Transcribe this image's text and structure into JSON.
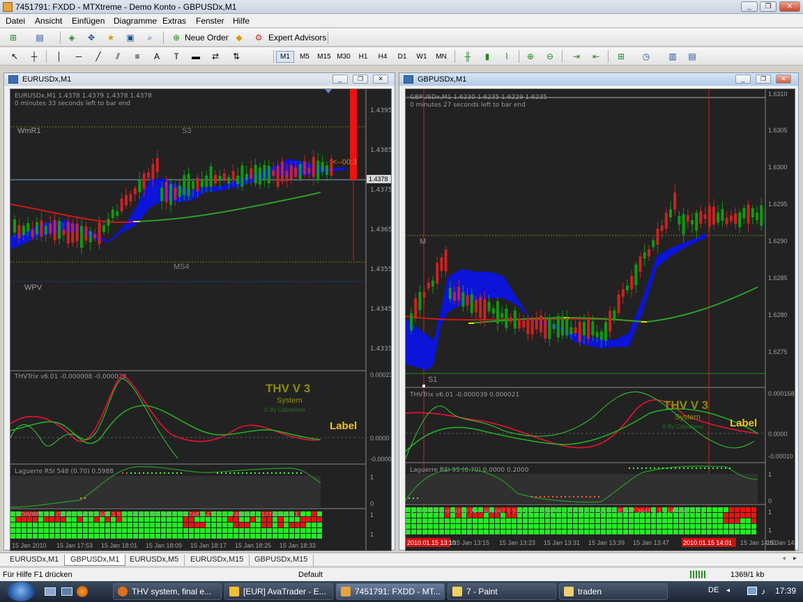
{
  "window": {
    "title": "7451791: FXDD - MTXtreme - Demo Konto - GBPUSDx,M1"
  },
  "menu": [
    "Datei",
    "Ansicht",
    "Einfügen",
    "Diagramme",
    "Extras",
    "Fenster",
    "Hilfe"
  ],
  "toolbar1": {
    "new_order": "Neue Order",
    "expert_advisors": "Expert Advisors"
  },
  "timeframes": [
    "M1",
    "M5",
    "M15",
    "M30",
    "H1",
    "H4",
    "D1",
    "W1",
    "MN"
  ],
  "active_timeframe": "M1",
  "chart_left": {
    "title": "EURUSDx,M1",
    "info": "EURUSDx,M1  1.4378 1.4379 1.4378 1.4378",
    "timer": "0 minutes 33 seconds left to bar end",
    "levels": {
      "wmr1": "WmR1",
      "s3": "S3",
      "ms4": "MS4",
      "wpv": "WPV"
    },
    "countdown": "<--00:3",
    "price_current": "1.4378",
    "prices": [
      "1.4395",
      "1.4385",
      "1.4375",
      "1.4365",
      "1.4355",
      "1.4345",
      "1.4335"
    ],
    "trix_label": "THVTrix v6.01 -0.000008 -0.000026",
    "trix_scale": [
      "0.000231",
      "0.0000",
      "-0.00008"
    ],
    "thv_title": "THV V 3",
    "thv_system": "System",
    "thv_by": "© By Cobraforex",
    "thv_label": "Label",
    "laguerre_label": "Laguerre RSI 548 (0.70) 0.5988",
    "laguerre_scale": [
      "1",
      "0"
    ],
    "mtf_label": "1 THVMFTrend (9263 2147483647 1 5) 2147483647 3647 2147483647 3 2147483647 2147483647 1",
    "mtf_scale": [
      "1",
      "1"
    ],
    "times": [
      "15 Jan 2010",
      "15 Jan 17:53",
      "15 Jan 18:01",
      "15 Jan 18:09",
      "15 Jan 18:17",
      "15 Jan 18:25",
      "15 Jan 18:33"
    ]
  },
  "chart_right": {
    "title": "GBPUSDx,M1",
    "info": "GBPUSDx,M1  1.6230 1.6235 1.6229 1.6235",
    "timer": "0 minutes 27 seconds left to bar end",
    "levels": {
      "s1": "S1",
      "m": "M"
    },
    "prices": [
      "1.6310",
      "1.6305",
      "1.6300",
      "1.6295",
      "1.6290",
      "1.6285",
      "1.6280",
      "1.6275"
    ],
    "trix_label": "THVTrix v6.01 -0.000039 0.000021",
    "trix_scale": [
      "0.000168",
      "0.0000",
      "-0.00010"
    ],
    "thv_title": "THV V 3",
    "thv_system": "System",
    "thv_by": "© By Cobraforex",
    "thv_label": "Label",
    "laguerre_label": "Laguerre RSI 95 (0.70) 0.0000 0.2000",
    "laguerre_scale": [
      "1",
      "0"
    ],
    "mtf_label": "1 THVMFTrend (9263 2147483647 1 5) 3 2147483647 2147483647 2147483647 3647 2 1 2147483647 1",
    "mtf_scale": [
      "1",
      "1"
    ],
    "times": [
      "2010.01.15 13:10",
      "15 Jan 13:15",
      "15 Jan 13:23",
      "15 Jan 13:31",
      "15 Jan 13:39",
      "15 Jan 13:47",
      "2010.01.15 14:01",
      "15 Jan 14:03",
      "15 Jan 14"
    ]
  },
  "tabs": [
    "EURUSDx,M1",
    "GBPUSDx,M1",
    "EURUSDx,M5",
    "EURUSDx,M15",
    "GBPUSDx,M15"
  ],
  "active_tab": "GBPUSDx,M1",
  "status": {
    "help": "Für Hilfe F1 drücken",
    "profile": "Default",
    "traffic": "1369/1 kb"
  },
  "taskbar": {
    "items": [
      "THV system, final e...",
      "[EUR] AvaTrader - E...",
      "7451791: FXDD - MT...",
      "7 - Paint",
      "traden"
    ],
    "lang": "DE",
    "clock": "17:39"
  },
  "colors": {
    "chart_bg": "#222222",
    "bull": "#119911",
    "bear": "#cc2222",
    "cloud": "#0b14d8",
    "ma_green": "#2aa02a",
    "ma_red": "#d01818"
  }
}
